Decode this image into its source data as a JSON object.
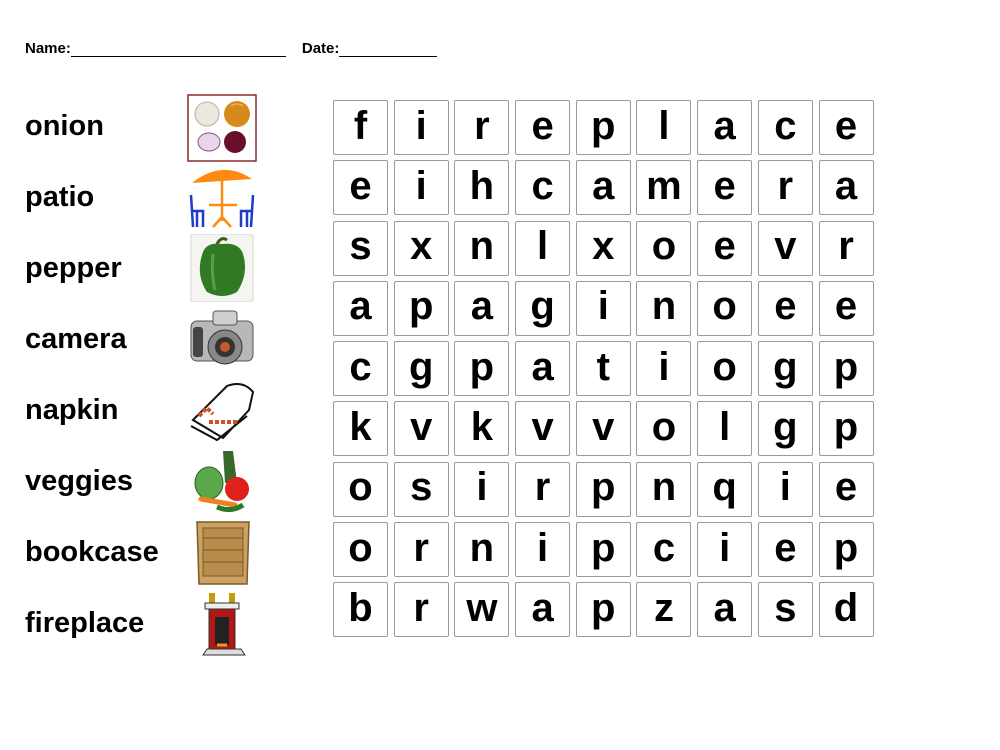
{
  "header": {
    "name_label": "Name:",
    "date_label": "Date:"
  },
  "words": [
    {
      "word": "onion",
      "icon": "onion-icon"
    },
    {
      "word": "patio",
      "icon": "patio-icon"
    },
    {
      "word": "pepper",
      "icon": "pepper-icon"
    },
    {
      "word": "camera",
      "icon": "camera-icon"
    },
    {
      "word": "napkin",
      "icon": "napkin-icon"
    },
    {
      "word": "veggies",
      "icon": "veggies-icon"
    },
    {
      "word": "bookcase",
      "icon": "bookcase-icon"
    },
    {
      "word": "fireplace",
      "icon": "fireplace-icon"
    }
  ],
  "grid": [
    [
      "f",
      "i",
      "r",
      "e",
      "p",
      "l",
      "a",
      "c",
      "e"
    ],
    [
      "e",
      "i",
      "h",
      "c",
      "a",
      "m",
      "e",
      "r",
      "a"
    ],
    [
      "s",
      "x",
      "n",
      "l",
      "x",
      "o",
      "e",
      "v",
      "r"
    ],
    [
      "a",
      "p",
      "a",
      "g",
      "i",
      "n",
      "o",
      "e",
      "e"
    ],
    [
      "c",
      "g",
      "p",
      "a",
      "t",
      "i",
      "o",
      "g",
      "p"
    ],
    [
      "k",
      "v",
      "k",
      "v",
      "v",
      "o",
      "l",
      "g",
      "p"
    ],
    [
      "o",
      "s",
      "i",
      "r",
      "p",
      "n",
      "q",
      "i",
      "e"
    ],
    [
      "o",
      "r",
      "n",
      "i",
      "p",
      "c",
      "i",
      "e",
      "p"
    ],
    [
      "b",
      "r",
      "w",
      "a",
      "p",
      "z",
      "a",
      "s",
      "d"
    ]
  ]
}
